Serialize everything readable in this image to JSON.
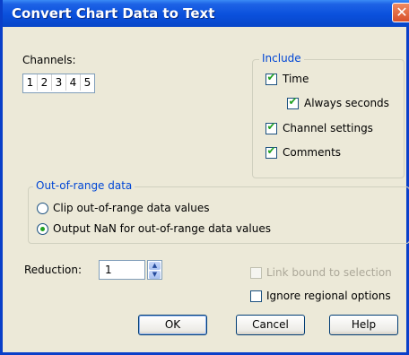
{
  "window": {
    "title": "Convert Chart Data to Text",
    "close_symbol": "✕"
  },
  "channels": {
    "label": "Channels:",
    "items": [
      "1",
      "2",
      "3",
      "4",
      "5"
    ]
  },
  "include": {
    "title": "Include",
    "time": {
      "label": "Time",
      "checked": true
    },
    "always_seconds": {
      "label": "Always seconds",
      "checked": true
    },
    "channel_settings": {
      "label": "Channel settings",
      "checked": true
    },
    "comments": {
      "label": "Comments",
      "checked": true
    }
  },
  "out_of_range": {
    "title": "Out-of-range data",
    "clip": {
      "label": "Clip out-of-range data values",
      "selected": false
    },
    "nan": {
      "label": "Output NaN for out-of-range data values",
      "selected": true
    }
  },
  "reduction": {
    "label": "Reduction:",
    "value": "1"
  },
  "link_bound": {
    "label": "Link bound to selection",
    "checked": false,
    "enabled": false
  },
  "ignore_regional": {
    "label": "Ignore regional options",
    "checked": false
  },
  "buttons": {
    "ok": "OK",
    "cancel": "Cancel",
    "help": "Help"
  },
  "colors": {
    "title_bar": "#0a50dc",
    "accent": "#0046d5",
    "check": "#21a121",
    "dialog_bg": "#ece9d8"
  },
  "icons": {
    "check": "✔",
    "spin_up": "▲",
    "spin_down": "▼"
  }
}
